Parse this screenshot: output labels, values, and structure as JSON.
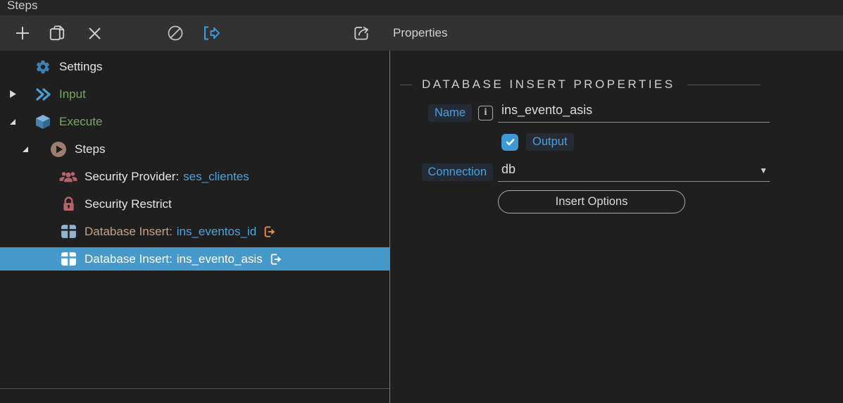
{
  "window": {
    "title": "Steps"
  },
  "toolbar": {
    "properties_title": "Properties",
    "left_icon_names": [
      "add-icon",
      "copy-icon",
      "close-icon",
      "disable-icon",
      "export-icon"
    ],
    "right_icon_names": [
      "share-icon"
    ]
  },
  "icons": {
    "info_glyph": "i",
    "dropdown_glyph": "▼",
    "check_glyph": "✓",
    "map": {
      "add-icon": "+",
      "copy-icon": "⧉",
      "close-icon": "✕",
      "disable-icon": "⊘",
      "export-icon": "[→",
      "share-icon": "↗",
      "gear-icon": "⚙",
      "double-chevron-icon": "»",
      "cube-icon": "⬡",
      "play-icon": "▶",
      "users-icon": "👥",
      "lock-icon": "🔒",
      "table-icon": "▦",
      "exit-icon": "⇥",
      "expander-collapsed": "▶",
      "expander-expanded": "◢"
    }
  },
  "tree": {
    "items": [
      {
        "label": "Settings",
        "icon": "gear-icon",
        "level": 1,
        "expander": "none"
      },
      {
        "label": "Input",
        "icon": "double-chevron-icon",
        "level": 1,
        "expander": "collapsed"
      },
      {
        "label": "Execute",
        "icon": "cube-icon",
        "level": 1,
        "expander": "expanded"
      },
      {
        "label": "Steps",
        "icon": "play-icon",
        "level": 2,
        "expander": "expanded"
      },
      {
        "label": "Security Provider:",
        "link": "ses_clientes",
        "icon": "users-icon",
        "level": 3
      },
      {
        "label": "Security Restrict",
        "icon": "lock-icon",
        "level": 3
      },
      {
        "label": "Database Insert:",
        "link": "ins_eventos_id",
        "icon": "table-icon",
        "suffix_icon": "exit-icon",
        "level": 3
      },
      {
        "label": "Database Insert:",
        "link": "ins_evento_asis",
        "icon": "table-icon",
        "suffix_icon": "exit-icon",
        "level": 3,
        "selected": true
      }
    ]
  },
  "properties": {
    "heading": "DATABASE INSERT PROPERTIES",
    "name_label": "Name",
    "name_value": "ins_evento_asis",
    "output_label": "Output",
    "output_checked": true,
    "connection_label": "Connection",
    "connection_value": "db",
    "insert_options_label": "Insert Options"
  },
  "colors": {
    "selection_blue": "#4699cb",
    "accent_blue": "#4ba0df",
    "checkbox_blue": "#3e9ad6",
    "green_text": "#76a95f",
    "tan_text": "#c7a284",
    "orange_icon": "#d8904e",
    "red_icon": "#b5646b",
    "icon_blue": "#3f7fb5",
    "toolbar_bg": "#323232",
    "panel_bg": "#1f1f1f"
  }
}
